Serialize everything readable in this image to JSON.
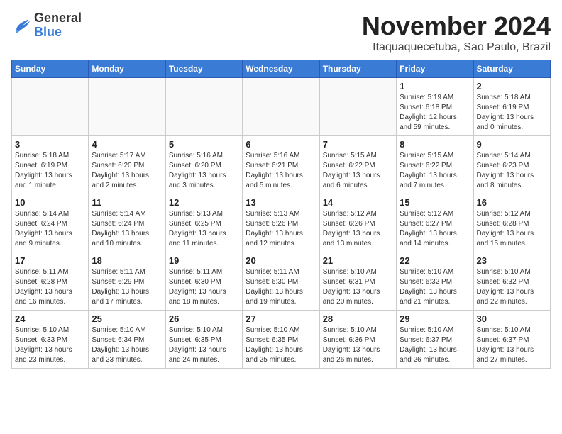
{
  "header": {
    "logo_general": "General",
    "logo_blue": "Blue",
    "month_title": "November 2024",
    "location": "Itaquaquecetuba, Sao Paulo, Brazil"
  },
  "weekdays": [
    "Sunday",
    "Monday",
    "Tuesday",
    "Wednesday",
    "Thursday",
    "Friday",
    "Saturday"
  ],
  "weeks": [
    [
      {
        "day": "",
        "info": ""
      },
      {
        "day": "",
        "info": ""
      },
      {
        "day": "",
        "info": ""
      },
      {
        "day": "",
        "info": ""
      },
      {
        "day": "",
        "info": ""
      },
      {
        "day": "1",
        "info": "Sunrise: 5:19 AM\nSunset: 6:18 PM\nDaylight: 12 hours and 59 minutes."
      },
      {
        "day": "2",
        "info": "Sunrise: 5:18 AM\nSunset: 6:19 PM\nDaylight: 13 hours and 0 minutes."
      }
    ],
    [
      {
        "day": "3",
        "info": "Sunrise: 5:18 AM\nSunset: 6:19 PM\nDaylight: 13 hours and 1 minute."
      },
      {
        "day": "4",
        "info": "Sunrise: 5:17 AM\nSunset: 6:20 PM\nDaylight: 13 hours and 2 minutes."
      },
      {
        "day": "5",
        "info": "Sunrise: 5:16 AM\nSunset: 6:20 PM\nDaylight: 13 hours and 3 minutes."
      },
      {
        "day": "6",
        "info": "Sunrise: 5:16 AM\nSunset: 6:21 PM\nDaylight: 13 hours and 5 minutes."
      },
      {
        "day": "7",
        "info": "Sunrise: 5:15 AM\nSunset: 6:22 PM\nDaylight: 13 hours and 6 minutes."
      },
      {
        "day": "8",
        "info": "Sunrise: 5:15 AM\nSunset: 6:22 PM\nDaylight: 13 hours and 7 minutes."
      },
      {
        "day": "9",
        "info": "Sunrise: 5:14 AM\nSunset: 6:23 PM\nDaylight: 13 hours and 8 minutes."
      }
    ],
    [
      {
        "day": "10",
        "info": "Sunrise: 5:14 AM\nSunset: 6:24 PM\nDaylight: 13 hours and 9 minutes."
      },
      {
        "day": "11",
        "info": "Sunrise: 5:14 AM\nSunset: 6:24 PM\nDaylight: 13 hours and 10 minutes."
      },
      {
        "day": "12",
        "info": "Sunrise: 5:13 AM\nSunset: 6:25 PM\nDaylight: 13 hours and 11 minutes."
      },
      {
        "day": "13",
        "info": "Sunrise: 5:13 AM\nSunset: 6:26 PM\nDaylight: 13 hours and 12 minutes."
      },
      {
        "day": "14",
        "info": "Sunrise: 5:12 AM\nSunset: 6:26 PM\nDaylight: 13 hours and 13 minutes."
      },
      {
        "day": "15",
        "info": "Sunrise: 5:12 AM\nSunset: 6:27 PM\nDaylight: 13 hours and 14 minutes."
      },
      {
        "day": "16",
        "info": "Sunrise: 5:12 AM\nSunset: 6:28 PM\nDaylight: 13 hours and 15 minutes."
      }
    ],
    [
      {
        "day": "17",
        "info": "Sunrise: 5:11 AM\nSunset: 6:28 PM\nDaylight: 13 hours and 16 minutes."
      },
      {
        "day": "18",
        "info": "Sunrise: 5:11 AM\nSunset: 6:29 PM\nDaylight: 13 hours and 17 minutes."
      },
      {
        "day": "19",
        "info": "Sunrise: 5:11 AM\nSunset: 6:30 PM\nDaylight: 13 hours and 18 minutes."
      },
      {
        "day": "20",
        "info": "Sunrise: 5:11 AM\nSunset: 6:30 PM\nDaylight: 13 hours and 19 minutes."
      },
      {
        "day": "21",
        "info": "Sunrise: 5:10 AM\nSunset: 6:31 PM\nDaylight: 13 hours and 20 minutes."
      },
      {
        "day": "22",
        "info": "Sunrise: 5:10 AM\nSunset: 6:32 PM\nDaylight: 13 hours and 21 minutes."
      },
      {
        "day": "23",
        "info": "Sunrise: 5:10 AM\nSunset: 6:32 PM\nDaylight: 13 hours and 22 minutes."
      }
    ],
    [
      {
        "day": "24",
        "info": "Sunrise: 5:10 AM\nSunset: 6:33 PM\nDaylight: 13 hours and 23 minutes."
      },
      {
        "day": "25",
        "info": "Sunrise: 5:10 AM\nSunset: 6:34 PM\nDaylight: 13 hours and 23 minutes."
      },
      {
        "day": "26",
        "info": "Sunrise: 5:10 AM\nSunset: 6:35 PM\nDaylight: 13 hours and 24 minutes."
      },
      {
        "day": "27",
        "info": "Sunrise: 5:10 AM\nSunset: 6:35 PM\nDaylight: 13 hours and 25 minutes."
      },
      {
        "day": "28",
        "info": "Sunrise: 5:10 AM\nSunset: 6:36 PM\nDaylight: 13 hours and 26 minutes."
      },
      {
        "day": "29",
        "info": "Sunrise: 5:10 AM\nSunset: 6:37 PM\nDaylight: 13 hours and 26 minutes."
      },
      {
        "day": "30",
        "info": "Sunrise: 5:10 AM\nSunset: 6:37 PM\nDaylight: 13 hours and 27 minutes."
      }
    ]
  ]
}
